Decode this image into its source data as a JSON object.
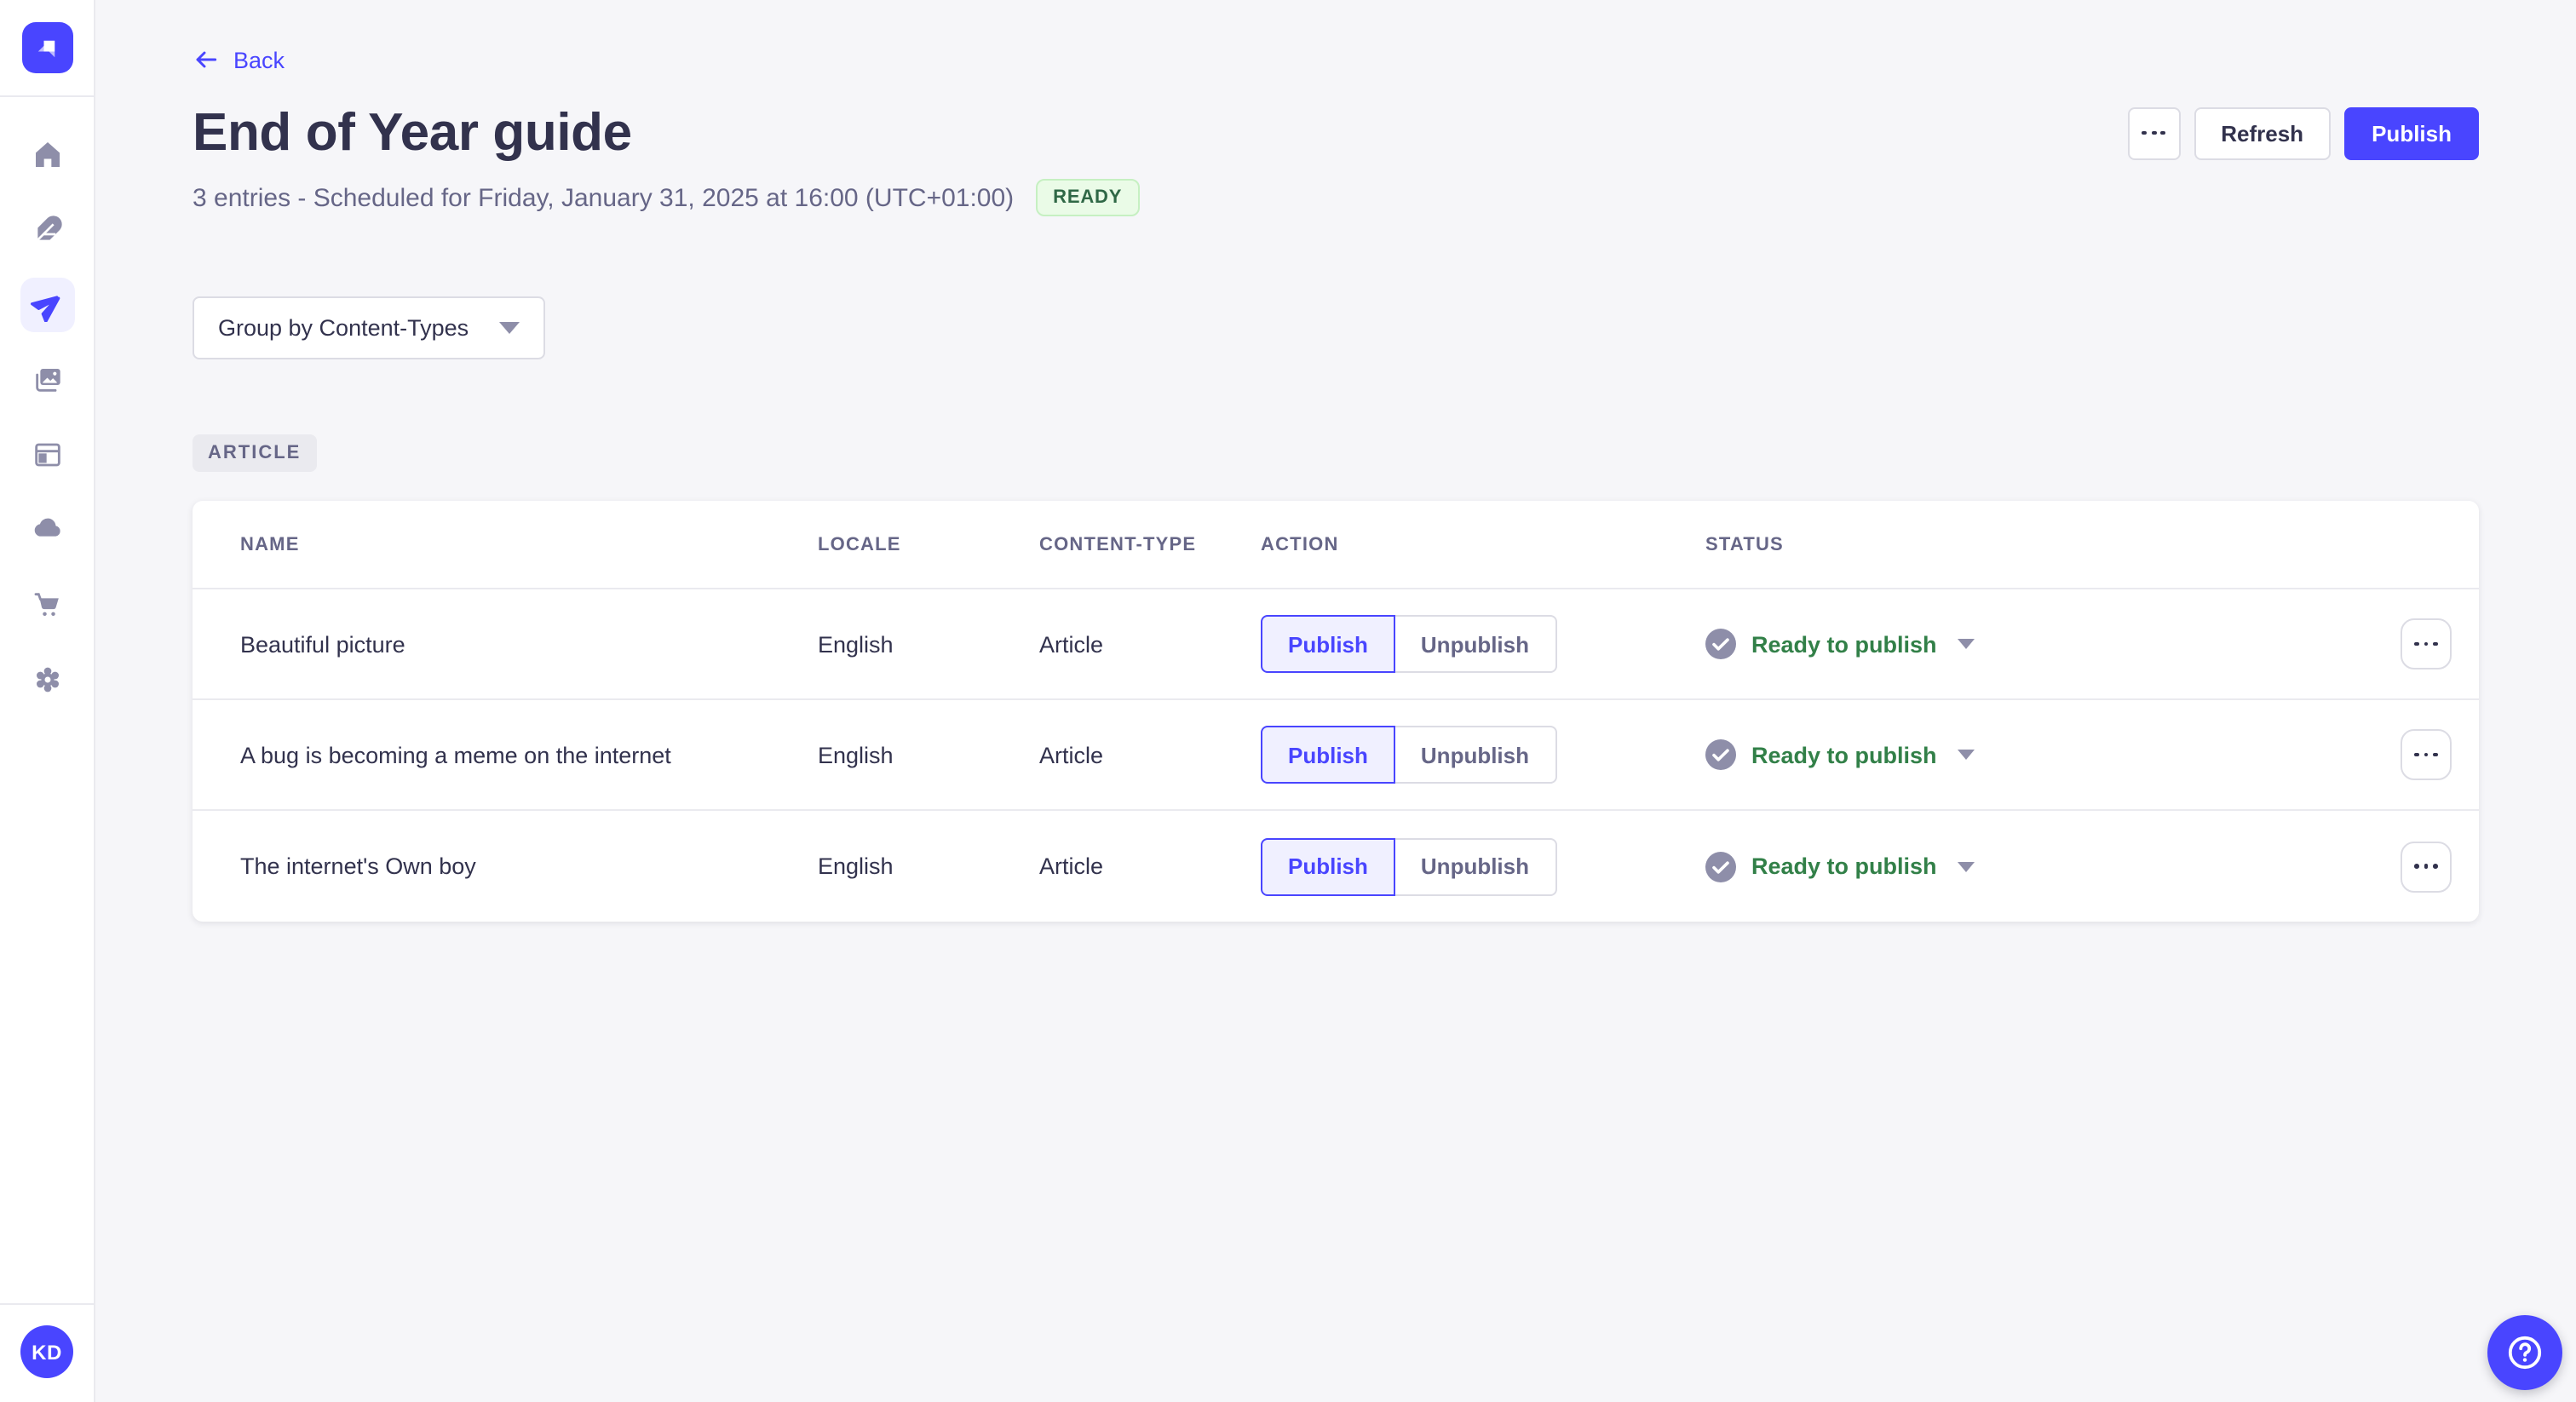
{
  "sidebar": {
    "logo": "strapi-logo",
    "items": [
      {
        "name": "home",
        "icon": "home-icon",
        "active": false
      },
      {
        "name": "content-manager",
        "icon": "feather-icon",
        "active": false
      },
      {
        "name": "releases",
        "icon": "paper-plane-icon",
        "active": true
      },
      {
        "name": "media-library",
        "icon": "images-icon",
        "active": false
      },
      {
        "name": "content-type-builder",
        "icon": "layout-icon",
        "active": false
      },
      {
        "name": "deploy",
        "icon": "cloud-icon",
        "active": false
      },
      {
        "name": "marketplace",
        "icon": "cart-icon",
        "active": false
      },
      {
        "name": "settings",
        "icon": "gear-icon",
        "active": false
      }
    ],
    "user_initials": "KD"
  },
  "header": {
    "back_label": "Back",
    "title": "End of Year guide",
    "subtitle": "3 entries - Scheduled for Friday, January 31, 2025 at 16:00 (UTC+01:00)",
    "status_badge": "READY",
    "refresh_label": "Refresh",
    "publish_label": "Publish"
  },
  "controls": {
    "group_by_label": "Group by Content-Types"
  },
  "group_badge": "ARTICLE",
  "table": {
    "columns": [
      "NAME",
      "LOCALE",
      "CONTENT-TYPE",
      "ACTION",
      "STATUS"
    ],
    "rows": [
      {
        "name": "Beautiful picture",
        "locale": "English",
        "content_type": "Article",
        "publish_label": "Publish",
        "unpublish_label": "Unpublish",
        "status": "Ready to publish"
      },
      {
        "name": "A bug is becoming a meme on the internet",
        "locale": "English",
        "content_type": "Article",
        "publish_label": "Publish",
        "unpublish_label": "Unpublish",
        "status": "Ready to publish"
      },
      {
        "name": "The internet's Own boy",
        "locale": "English",
        "content_type": "Article",
        "publish_label": "Publish",
        "unpublish_label": "Unpublish",
        "status": "Ready to publish"
      }
    ]
  },
  "colors": {
    "accent": "#4945ff",
    "accent_light": "#f0f0ff",
    "success_text": "#328048",
    "success_bg": "#eafbe7",
    "success_border": "#c6f0c2",
    "text": "#32324d",
    "muted": "#666687",
    "icon_gray": "#8e8ea9",
    "border": "#dcdce4",
    "divider": "#eaeaef",
    "page_bg": "#f6f6f9"
  }
}
